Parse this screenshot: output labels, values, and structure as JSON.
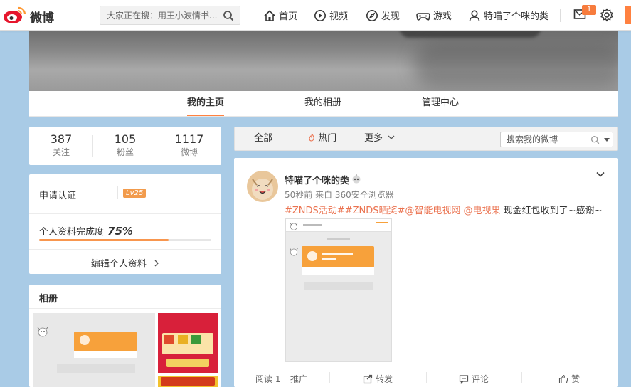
{
  "brand": {
    "name": "微博"
  },
  "search": {
    "placeholder": "大家正在搜：用王小波情书..."
  },
  "nav": {
    "items": [
      {
        "label": "首页",
        "icon": "home-icon"
      },
      {
        "label": "视频",
        "icon": "video-icon"
      },
      {
        "label": "发现",
        "icon": "compass-icon"
      },
      {
        "label": "游戏",
        "icon": "gamepad-icon"
      },
      {
        "label": "特喵了个咪的类",
        "icon": "user-icon"
      }
    ],
    "message_badge": "1"
  },
  "profile_tabs": [
    {
      "label": "我的主页",
      "active": true
    },
    {
      "label": "我的相册",
      "active": false
    },
    {
      "label": "管理中心",
      "active": false
    }
  ],
  "stats": [
    {
      "value": "387",
      "label": "关注"
    },
    {
      "value": "105",
      "label": "粉丝"
    },
    {
      "value": "1117",
      "label": "微博"
    }
  ],
  "verify": {
    "label": "申请认证",
    "level": "Lv25",
    "completion_label": "个人资料完成度",
    "completion_value": "75%",
    "completion_fraction": 0.75,
    "edit_label": "编辑个人资料"
  },
  "album": {
    "title": "相册"
  },
  "filter": {
    "tabs": [
      "全部",
      "热门",
      "更多"
    ],
    "search_placeholder": "搜索我的微博"
  },
  "post": {
    "username": "特喵了个咪的类",
    "meta": "50秒前 来自 360安全浏览器",
    "text_segments": [
      {
        "text": "#ZNDS活动#",
        "link": true
      },
      {
        "text": "#ZNDS晒奖#",
        "link": true
      },
      {
        "text": "@智能电视网",
        "link": true
      },
      {
        "text": " ",
        "link": false
      },
      {
        "text": "@电视果",
        "link": true
      },
      {
        "text": " 现金红包收到了~感谢~",
        "link": false
      }
    ],
    "actions": [
      {
        "label": "阅读 1"
      },
      {
        "label": "推广"
      },
      {
        "label": "转发",
        "icon": "share-icon"
      },
      {
        "label": "评论",
        "icon": "comment-icon"
      },
      {
        "label": "赞",
        "icon": "thumbs-up-icon"
      }
    ]
  },
  "colors": {
    "accent": "#ff8140",
    "link": "#eb7350",
    "background": "#a9cbe6"
  }
}
